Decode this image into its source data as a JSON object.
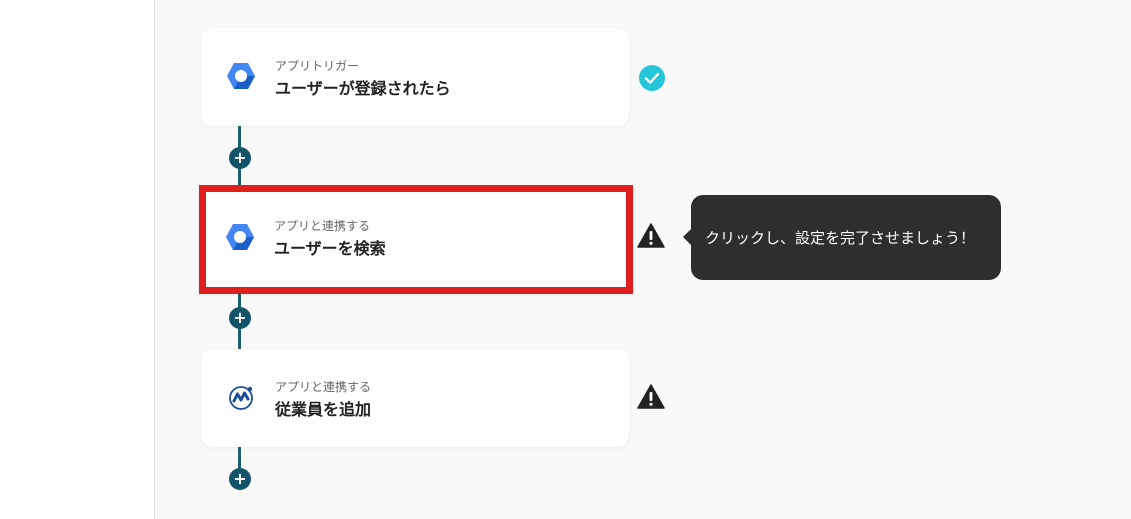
{
  "flow": {
    "steps": [
      {
        "type_label": "アプリトリガー",
        "title": "ユーザーが登録されたら",
        "app_icon": "google-workspace-icon",
        "status": "complete"
      },
      {
        "type_label": "アプリと連携する",
        "title": "ユーザーを検索",
        "app_icon": "google-workspace-icon",
        "status": "warning"
      },
      {
        "type_label": "アプリと連携する",
        "title": "従業員を追加",
        "app_icon": "money-forward-icon",
        "status": "warning"
      }
    ],
    "add_step_label": "+"
  },
  "tooltip": {
    "text": "クリックし、設定を完了させましょう！"
  },
  "colors": {
    "connector": "#1d5f6e",
    "complete": "#26c6da",
    "warning": "#222222",
    "highlight_border": "#e01e1e",
    "tooltip_bg": "#2e2e2e"
  }
}
